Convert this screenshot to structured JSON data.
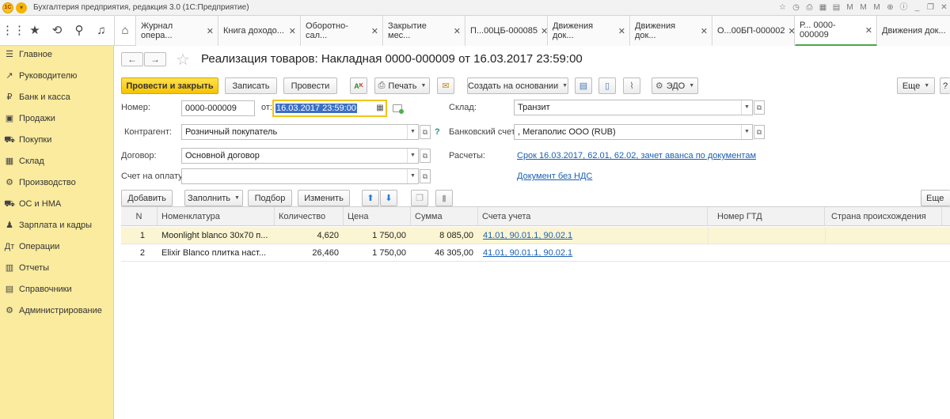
{
  "window": {
    "title": "Бухгалтерия предприятия, редакция 3.0  (1С:Предприятие)",
    "logo_text": "1С"
  },
  "tabs": [
    {
      "label": "Журнал опера..."
    },
    {
      "label": "Книга доходо..."
    },
    {
      "label": "Оборотно-сал..."
    },
    {
      "label": "Закрытие мес..."
    },
    {
      "label": "П...00ЦБ-000085"
    },
    {
      "label": "Движения док..."
    },
    {
      "label": "Движения док..."
    },
    {
      "label": "О...00БП-000002"
    },
    {
      "label": "Р...  0000-000009"
    },
    {
      "label": "Движения док..."
    }
  ],
  "sidebar": {
    "items": [
      {
        "label": "Главное",
        "icon": "menu-lines-icon"
      },
      {
        "label": "Руководителю",
        "icon": "trend-chart-icon"
      },
      {
        "label": "Банк и касса",
        "icon": "ruble-coin-icon"
      },
      {
        "label": "Продажи",
        "icon": "shopping-bag-icon"
      },
      {
        "label": "Покупки",
        "icon": "cart-icon"
      },
      {
        "label": "Склад",
        "icon": "warehouse-icon"
      },
      {
        "label": "Производство",
        "icon": "gears-icon"
      },
      {
        "label": "ОС и НМА",
        "icon": "truck-icon"
      },
      {
        "label": "Зарплата и кадры",
        "icon": "people-icon"
      },
      {
        "label": "Операции",
        "icon": "debit-credit-icon"
      },
      {
        "label": "Отчеты",
        "icon": "report-chart-icon"
      },
      {
        "label": "Справочники",
        "icon": "book-icon"
      },
      {
        "label": "Администрирование",
        "icon": "gear-icon"
      }
    ]
  },
  "document": {
    "title": "Реализация товаров: Накладная 0000-000009 от 16.03.2017 23:59:00"
  },
  "toolbar": {
    "post_close": "Провести и закрыть",
    "save": "Записать",
    "post": "Провести",
    "print": "Печать",
    "create_based": "Создать на основании",
    "edo": "ЭДО",
    "more": "Еще",
    "help": "?"
  },
  "form": {
    "number_label": "Номер:",
    "number_value": "0000-000009",
    "date_label": "от:",
    "date_value": "16.03.2017 23:59:00",
    "counterparty_label": "Контрагент:",
    "counterparty_value": "Розничный покупатель",
    "contract_label": "Договор:",
    "contract_value": "Основной договор",
    "invoice_label": "Счет на оплату:",
    "invoice_value": "",
    "warehouse_label": "Склад:",
    "warehouse_value": "Транзит",
    "bank_label": "Банковский счет:",
    "bank_value": ", Мегаполис ООО (RUB)",
    "settlements_label": "Расчеты:",
    "settlements_link": "Срок 16.03.2017, 62.01, 62.02, зачет аванса по документам",
    "vat_link": "Документ без НДС",
    "help_mark": "?"
  },
  "table_toolbar": {
    "add": "Добавить",
    "fill": "Заполнить",
    "pick": "Подбор",
    "change": "Изменить",
    "more": "Еще"
  },
  "table": {
    "columns": [
      "N",
      "Номенклатура",
      "Количество",
      "Цена",
      "Сумма",
      "Счета учета",
      "Номер ГТД",
      "Страна происхождения"
    ],
    "rows": [
      {
        "n": "1",
        "item": "Moonlight blanco 30x70 п...",
        "qty": "4,620",
        "price": "1 750,00",
        "sum": "8 085,00",
        "accounts": "41.01, 90.01.1, 90.02.1",
        "gtd": "",
        "country": "",
        "selected": true
      },
      {
        "n": "2",
        "item": "Elixir Blanco плитка наст...",
        "qty": "26,460",
        "price": "1 750,00",
        "sum": "46 305,00",
        "accounts": "41.01, 90.01.1, 90.02.1",
        "gtd": "",
        "country": "",
        "selected": false
      }
    ]
  },
  "colors": {
    "sidebar_bg": "#fbeb9e",
    "primary_button": "#f7c300",
    "link": "#1a5fb4",
    "selected_row": "#fcf5d3",
    "active_tab_underline": "#4ca64c"
  }
}
